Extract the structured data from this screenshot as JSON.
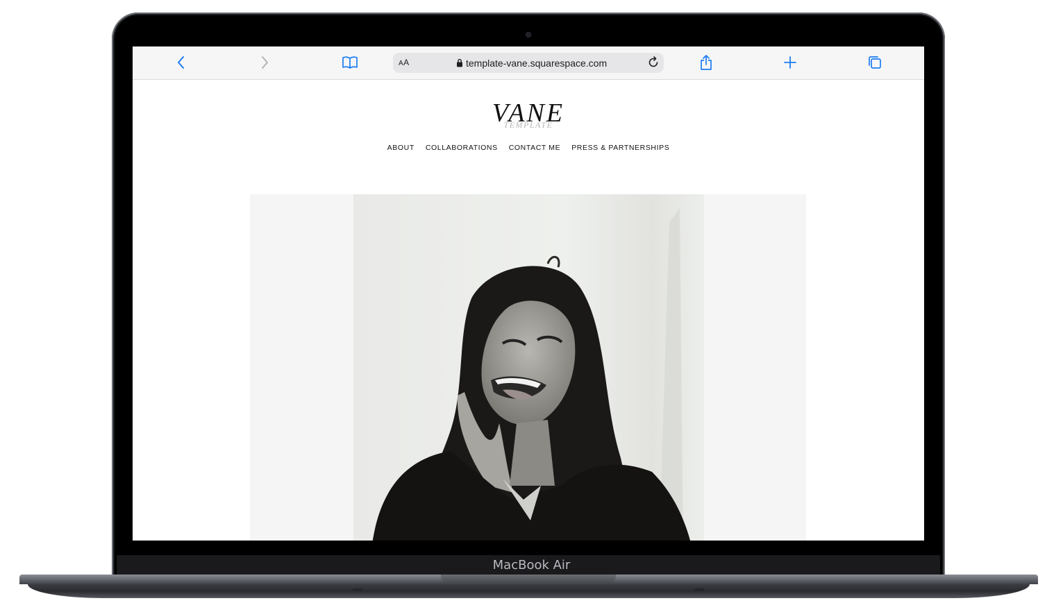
{
  "device": {
    "model_label": "MacBook Air"
  },
  "browser": {
    "url": "template-vane.squarespace.com",
    "reader_label_small": "A",
    "reader_label_large": "A",
    "icons": {
      "back": "chevron-left-icon",
      "forward": "chevron-right-icon",
      "bookmarks": "book-icon",
      "lock": "lock-icon",
      "reload": "reload-icon",
      "share": "share-icon",
      "new_tab": "plus-icon",
      "tabs": "tabs-icon"
    },
    "accent_color": "#1a7cf2"
  },
  "site": {
    "logo_text": "VANE",
    "logo_subtext": "TEMPLATE",
    "nav": [
      {
        "label": "ABOUT"
      },
      {
        "label": "COLLABORATIONS"
      },
      {
        "label": "CONTACT ME"
      },
      {
        "label": "PRESS & PARTNERSHIPS"
      }
    ],
    "hero_image": "black-and-white-portrait-photo"
  }
}
